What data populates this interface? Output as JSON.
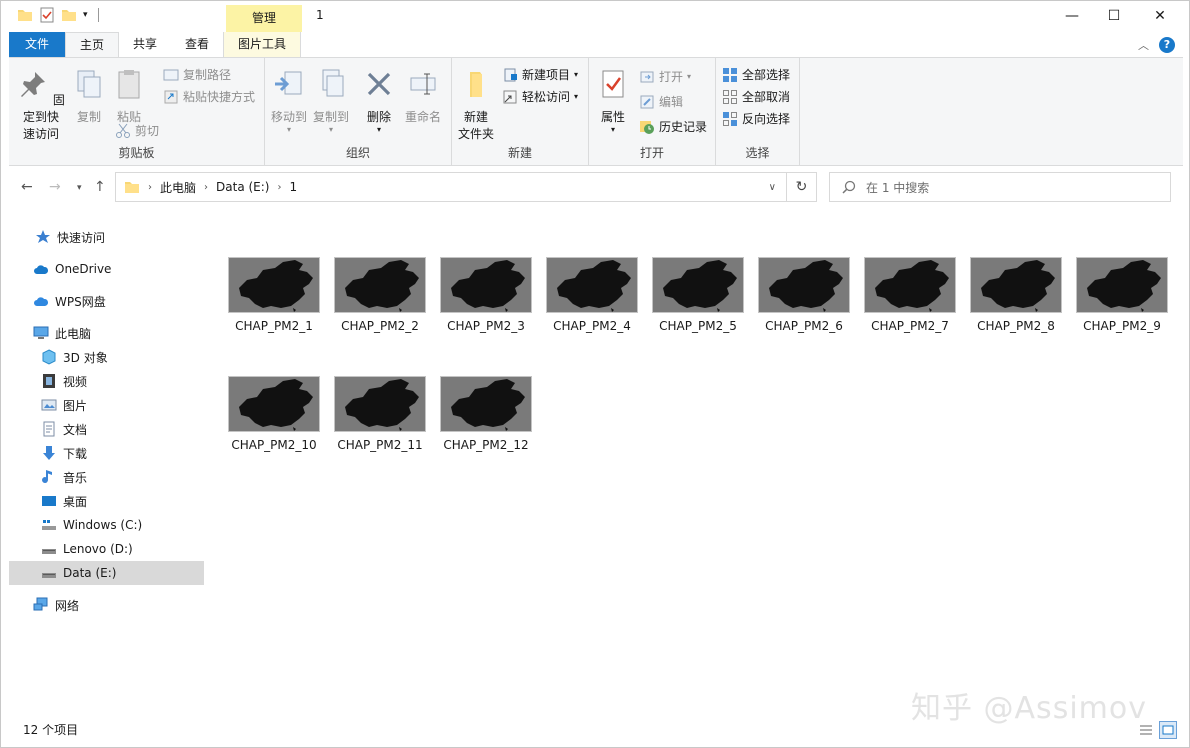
{
  "window": {
    "title": "1",
    "manage_tab": "管理"
  },
  "qat": {
    "icons": [
      "folder-icon",
      "properties-check-icon",
      "new-folder-icon",
      "dropdown-icon"
    ]
  },
  "controls": {
    "minimize": "—",
    "maximize": "☐",
    "close": "✕"
  },
  "tabs": {
    "file": "文件",
    "home": "主页",
    "share": "共享",
    "view": "查看",
    "picture_tools": "图片工具"
  },
  "ribbon": {
    "clipboard": {
      "label": "剪贴板",
      "pin": "固定到快\n速访问",
      "copy": "复制",
      "paste": "粘贴",
      "copy_path": "复制路径",
      "paste_shortcut": "粘贴快捷方式",
      "cut": "剪切"
    },
    "organize": {
      "label": "组织",
      "move_to": "移动到",
      "copy_to": "复制到",
      "delete": "删除",
      "rename": "重命名"
    },
    "new": {
      "label": "新建",
      "new_folder": "新建\n文件夹",
      "new_item": "新建项目",
      "easy_access": "轻松访问"
    },
    "open": {
      "label": "打开",
      "properties": "属性",
      "open": "打开",
      "edit": "编辑",
      "history": "历史记录"
    },
    "select": {
      "label": "选择",
      "select_all": "全部选择",
      "select_none": "全部取消",
      "invert": "反向选择"
    }
  },
  "address": {
    "parts": [
      "此电脑",
      "Data (E:)",
      "1"
    ],
    "search_placeholder": "在 1 中搜索"
  },
  "nav": {
    "quick_access": "快速访问",
    "onedrive": "OneDrive",
    "wps": "WPS网盘",
    "this_pc": "此电脑",
    "objects3d": "3D 对象",
    "videos": "视频",
    "pictures": "图片",
    "documents": "文档",
    "downloads": "下载",
    "music": "音乐",
    "desktop": "桌面",
    "drive_c": "Windows (C:)",
    "drive_d": "Lenovo (D:)",
    "drive_e": "Data (E:)",
    "network": "网络"
  },
  "files": [
    "CHAP_PM2_1",
    "CHAP_PM2_2",
    "CHAP_PM2_3",
    "CHAP_PM2_4",
    "CHAP_PM2_5",
    "CHAP_PM2_6",
    "CHAP_PM2_7",
    "CHAP_PM2_8",
    "CHAP_PM2_9",
    "CHAP_PM2_10",
    "CHAP_PM2_11",
    "CHAP_PM2_12"
  ],
  "status": {
    "count": "12 个项目"
  },
  "watermark": "知乎 @Assimov",
  "colors": {
    "file_tab": "#1979ca",
    "manage_tab": "#fcf3a5",
    "selected_nav": "#d9d9d9"
  }
}
